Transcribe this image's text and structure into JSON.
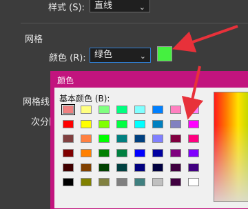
{
  "style_row": {
    "label": "样式 (S):",
    "value": "直线"
  },
  "grid": {
    "section_label": "网格",
    "color_label": "颜色 (R):",
    "color_value": "绿色",
    "swatch_color": "#45f040",
    "partial_label_line": "网格线间",
    "partial_label_sub": "次分隔"
  },
  "dialog": {
    "title": "颜色",
    "basic_colors_label": "基本颜色 (B):"
  },
  "basic_colors": [
    [
      "#f08080",
      "#ffff80",
      "#80ff80",
      "#00ff80",
      "#80ffff",
      "#0080ff",
      "#ff80c0",
      "#ff80ff"
    ],
    [
      "#ff0000",
      "#ffff00",
      "#80ff00",
      "#00ff40",
      "#00ffff",
      "#0080c0",
      "#8080c0",
      "#ff00ff"
    ],
    [
      "#804040",
      "#ff8040",
      "#00ff00",
      "#008080",
      "#004080",
      "#8080ff",
      "#800040",
      "#ff0080"
    ],
    [
      "#800000",
      "#ff8000",
      "#008000",
      "#008040",
      "#0000ff",
      "#0000a0",
      "#800080",
      "#8000ff"
    ],
    [
      "#400000",
      "#804000",
      "#004000",
      "#004040",
      "#000080",
      "#000040",
      "#400040",
      "#400080"
    ],
    [
      "#000000",
      "#808000",
      "#808040",
      "#808080",
      "#408080",
      "#c0c0c0",
      "#400040",
      "#ffffff"
    ]
  ],
  "colors": {
    "panel_bg": "#3c3c3c",
    "dialog_frame": "#c2147e",
    "annotation_arrow": "#e8313a",
    "focus_border": "#2f7fd6"
  }
}
